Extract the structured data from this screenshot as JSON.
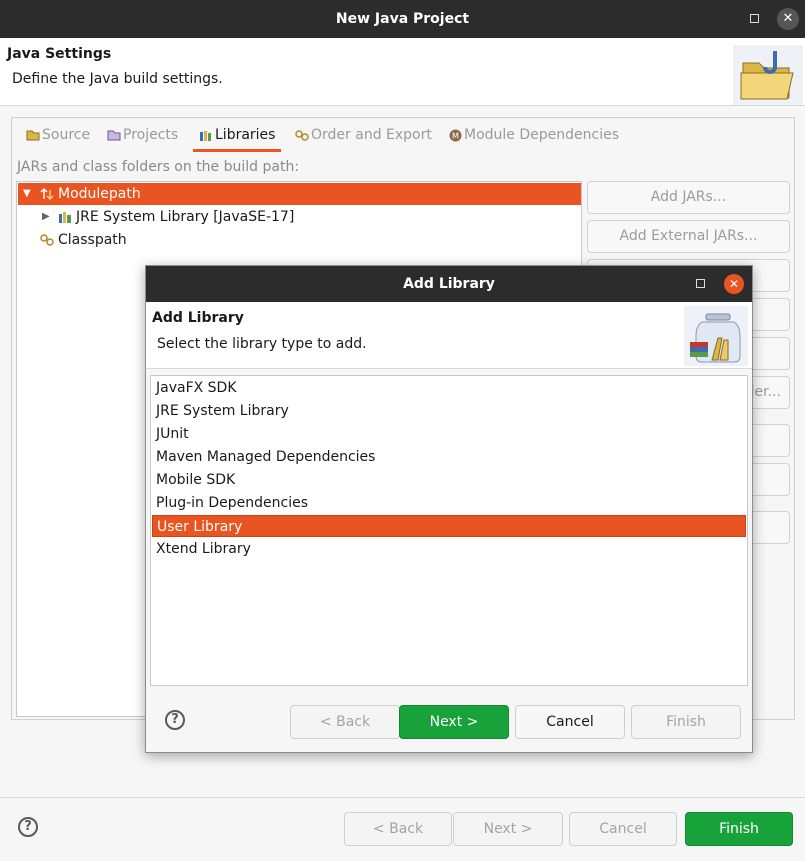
{
  "window": {
    "title": "New Java Project",
    "header_title": "Java Settings",
    "header_description": "Define the Java build settings."
  },
  "tabs": [
    {
      "label": "Source",
      "icon": "source-folder-icon",
      "active": false
    },
    {
      "label": "Projects",
      "icon": "projects-icon",
      "active": false
    },
    {
      "label": "Libraries",
      "icon": "libraries-icon",
      "active": true
    },
    {
      "label": "Order and Export",
      "icon": "order-export-icon",
      "active": false
    },
    {
      "label": "Module Dependencies",
      "icon": "module-icon",
      "active": false
    }
  ],
  "build_path": {
    "label": "JARs and class folders on the build path:",
    "tree": [
      {
        "label": "Modulepath",
        "expanded": true,
        "selected": true,
        "icon": "modulepath-icon"
      },
      {
        "label": "JRE System Library [JavaSE-17]",
        "expanded": false,
        "selected": false,
        "icon": "library-icon"
      },
      {
        "label": "Classpath",
        "selected": false,
        "icon": "classpath-icon"
      }
    ]
  },
  "side_buttons": {
    "add_jars": "Add JARs...",
    "add_external_jars": "Add External JARs...",
    "partial": "der..."
  },
  "footer": {
    "back": "< Back",
    "next": "Next >",
    "cancel": "Cancel",
    "finish": "Finish"
  },
  "dialog": {
    "title": "Add Library",
    "header_title": "Add Library",
    "header_description": "Select the library type to add.",
    "libraries": [
      "JavaFX SDK",
      "JRE System Library",
      "JUnit",
      "Maven Managed Dependencies",
      "Mobile SDK",
      "Plug-in Dependencies",
      "User Library",
      "Xtend Library"
    ],
    "selected": "User Library",
    "buttons": {
      "back": "< Back",
      "next": "Next >",
      "cancel": "Cancel",
      "finish": "Finish"
    }
  },
  "colors": {
    "accent": "#e95420",
    "primary_button": "#18a33a",
    "titlebar": "#2c2c2c"
  }
}
